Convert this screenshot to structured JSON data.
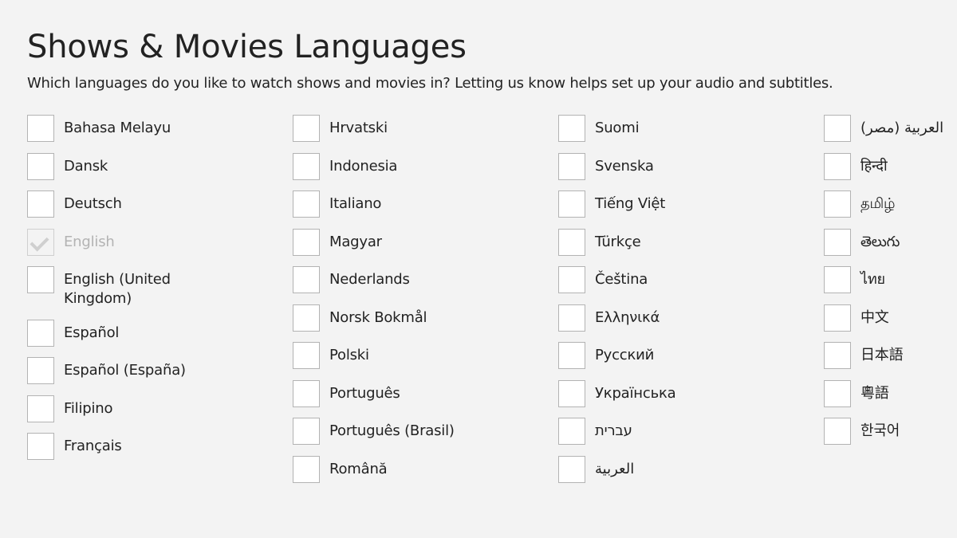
{
  "header": {
    "title": "Shows & Movies Languages",
    "subtitle": "Which languages do you like to watch shows and movies in? Letting us know helps set up your audio and subtitles."
  },
  "colors": {
    "background": "#f3f3f3",
    "text": "#222222",
    "checkbox_border": "#b3b3b3",
    "disabled_text": "#b3b3b3"
  },
  "columns": [
    [
      {
        "label": "Bahasa Melayu",
        "checked": false,
        "disabled": false
      },
      {
        "label": "Dansk",
        "checked": false,
        "disabled": false
      },
      {
        "label": "Deutsch",
        "checked": false,
        "disabled": false
      },
      {
        "label": "English",
        "checked": true,
        "disabled": true
      },
      {
        "label": "English (United Kingdom)",
        "checked": false,
        "disabled": false
      },
      {
        "label": "Español",
        "checked": false,
        "disabled": false
      },
      {
        "label": "Español (España)",
        "checked": false,
        "disabled": false
      },
      {
        "label": "Filipino",
        "checked": false,
        "disabled": false
      },
      {
        "label": "Français",
        "checked": false,
        "disabled": false
      }
    ],
    [
      {
        "label": "Hrvatski",
        "checked": false,
        "disabled": false
      },
      {
        "label": "Indonesia",
        "checked": false,
        "disabled": false
      },
      {
        "label": "Italiano",
        "checked": false,
        "disabled": false
      },
      {
        "label": "Magyar",
        "checked": false,
        "disabled": false
      },
      {
        "label": "Nederlands",
        "checked": false,
        "disabled": false
      },
      {
        "label": "Norsk Bokmål",
        "checked": false,
        "disabled": false
      },
      {
        "label": "Polski",
        "checked": false,
        "disabled": false
      },
      {
        "label": "Português",
        "checked": false,
        "disabled": false
      },
      {
        "label": "Português (Brasil)",
        "checked": false,
        "disabled": false
      },
      {
        "label": "Română",
        "checked": false,
        "disabled": false
      }
    ],
    [
      {
        "label": "Suomi",
        "checked": false,
        "disabled": false
      },
      {
        "label": "Svenska",
        "checked": false,
        "disabled": false
      },
      {
        "label": "Tiếng Việt",
        "checked": false,
        "disabled": false
      },
      {
        "label": "Türkçe",
        "checked": false,
        "disabled": false
      },
      {
        "label": "Čeština",
        "checked": false,
        "disabled": false
      },
      {
        "label": "Ελληνικά",
        "checked": false,
        "disabled": false
      },
      {
        "label": "Русский",
        "checked": false,
        "disabled": false
      },
      {
        "label": "Українська",
        "checked": false,
        "disabled": false
      },
      {
        "label": "עברית",
        "checked": false,
        "disabled": false
      },
      {
        "label": "العربية",
        "checked": false,
        "disabled": false
      }
    ],
    [
      {
        "label": "العربية (مصر)",
        "checked": false,
        "disabled": false
      },
      {
        "label": "हिन्दी",
        "checked": false,
        "disabled": false
      },
      {
        "label": "தமிழ்",
        "checked": false,
        "disabled": false
      },
      {
        "label": "తెలుగు",
        "checked": false,
        "disabled": false
      },
      {
        "label": "ไทย",
        "checked": false,
        "disabled": false
      },
      {
        "label": "中文",
        "checked": false,
        "disabled": false
      },
      {
        "label": "日本語",
        "checked": false,
        "disabled": false
      },
      {
        "label": "粵語",
        "checked": false,
        "disabled": false
      },
      {
        "label": "한국어",
        "checked": false,
        "disabled": false
      }
    ]
  ]
}
